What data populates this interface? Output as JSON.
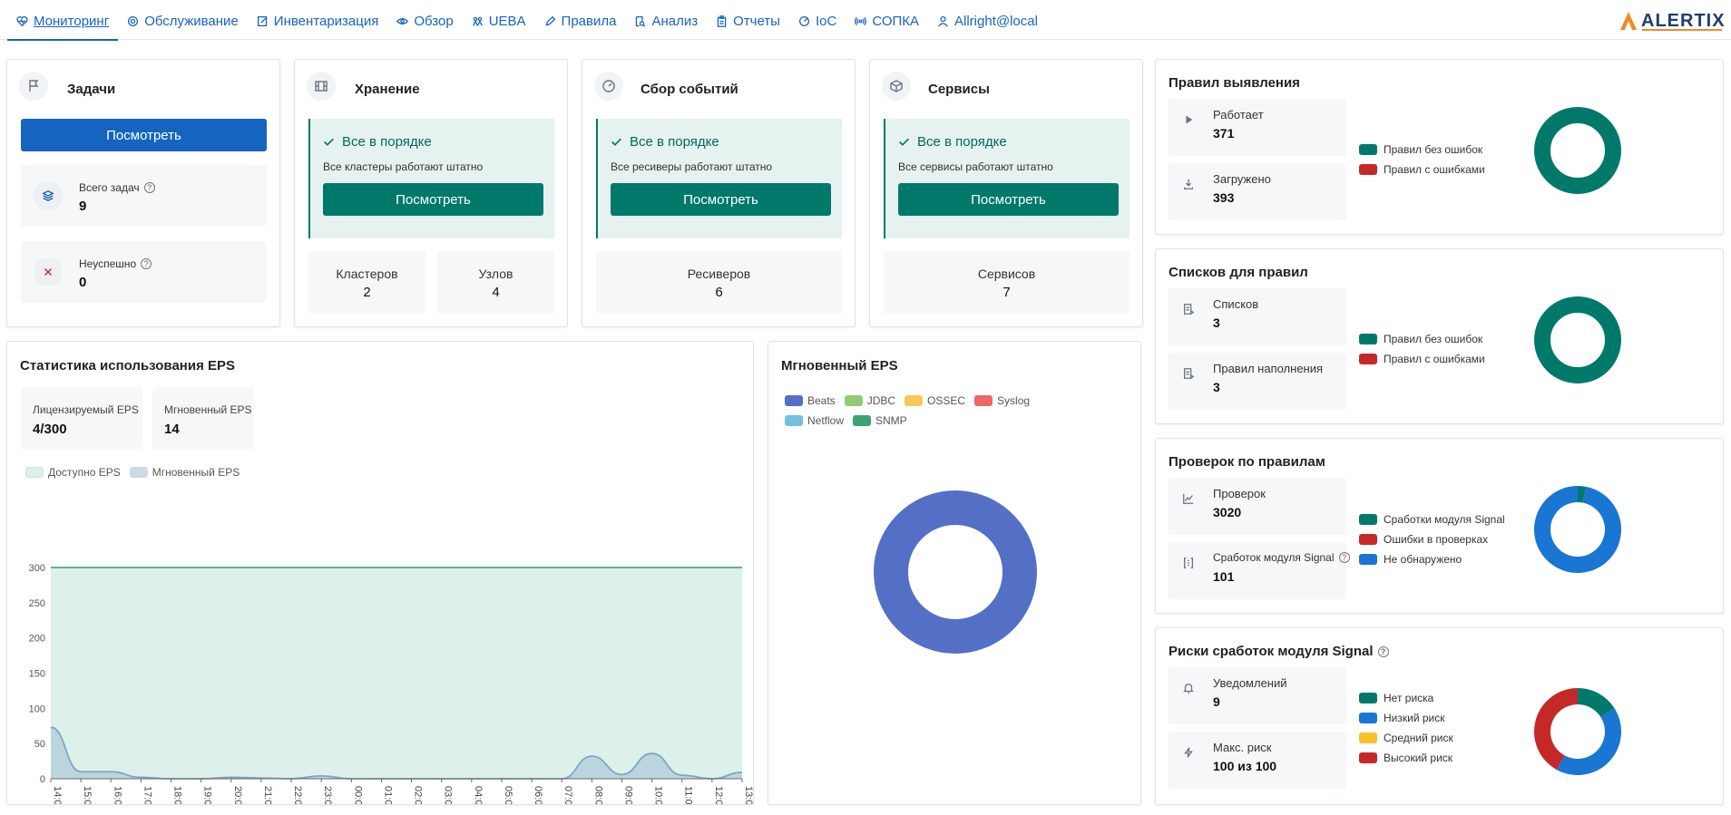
{
  "nav": {
    "items": [
      {
        "label": "Мониторинг",
        "icon": "heart-monitor-icon",
        "active": true
      },
      {
        "label": "Обслуживание",
        "icon": "gear-icon"
      },
      {
        "label": "Инвентаризация",
        "icon": "edit-icon"
      },
      {
        "label": "Обзор",
        "icon": "eye-icon"
      },
      {
        "label": "UEBA",
        "icon": "users-icon"
      },
      {
        "label": "Правила",
        "icon": "pencil-icon"
      },
      {
        "label": "Анализ",
        "icon": "search-doc-icon"
      },
      {
        "label": "Отчеты",
        "icon": "clipboard-icon"
      },
      {
        "label": "IoC",
        "icon": "target-icon"
      },
      {
        "label": "СОПКА",
        "icon": "broadcast-icon"
      },
      {
        "label": "Allright@local",
        "icon": "user-icon"
      }
    ],
    "layout_icon": "layout-columns-icon",
    "logo_text": "ALERTIX"
  },
  "tasks": {
    "title": "Задачи",
    "view_button": "Посмотреть",
    "total_label": "Всего задач",
    "total_value": "9",
    "failed_label": "Неуспешно",
    "failed_value": "0"
  },
  "storage": {
    "title": "Хранение",
    "ok_title": "Все в порядке",
    "ok_sub": "Все кластеры работают штатно",
    "view_button": "Посмотреть",
    "clusters_label": "Кластеров",
    "clusters_value": "2",
    "nodes_label": "Узлов",
    "nodes_value": "4"
  },
  "collection": {
    "title": "Сбор событий",
    "ok_title": "Все в порядке",
    "ok_sub": "Все ресиверы работают штатно",
    "view_button": "Посмотреть",
    "receivers_label": "Ресиверов",
    "receivers_value": "6"
  },
  "services": {
    "title": "Сервисы",
    "ok_title": "Все в порядке",
    "ok_sub": "Все сервисы работают штатно",
    "view_button": "Посмотреть",
    "services_label": "Сервисов",
    "services_value": "7"
  },
  "eps_stats": {
    "title": "Статистика использования EPS",
    "licensed_label": "Лицензируемый EPS",
    "licensed_value": "4/300",
    "instant_label": "Мгновенный EPS",
    "instant_value": "14",
    "legend_available": "Доступно EPS",
    "legend_instant": "Мгновенный EPS"
  },
  "instant_eps": {
    "title": "Мгновенный EPS",
    "legend": [
      {
        "name": "Beats",
        "color": "#5470c6"
      },
      {
        "name": "JDBC",
        "color": "#91cc75"
      },
      {
        "name": "OSSEC",
        "color": "#fac858"
      },
      {
        "name": "Syslog",
        "color": "#ee6666"
      },
      {
        "name": "Netflow",
        "color": "#73c0de"
      },
      {
        "name": "SNMP",
        "color": "#3ba272"
      }
    ]
  },
  "detection_rules": {
    "title": "Правил выявления",
    "running_label": "Работает",
    "running_value": "371",
    "loaded_label": "Загружено",
    "loaded_value": "393",
    "legend_ok": "Правил без ошибок",
    "legend_err": "Правил с ошибками"
  },
  "rule_lists": {
    "title": "Списков для правил",
    "lists_label": "Списков",
    "lists_value": "3",
    "fill_label": "Правил наполнения",
    "fill_value": "3",
    "legend_ok": "Правил без ошибок",
    "legend_err": "Правил с ошибками"
  },
  "rule_checks": {
    "title": "Проверок по правилам",
    "checks_label": "Проверок",
    "checks_value": "3020",
    "signal_label": "Сработок модуля Signal",
    "signal_value": "101",
    "legend_signal": "Сработки модуля Signal",
    "legend_errors": "Ошибки в проверках",
    "legend_notfound": "Не обнаружено"
  },
  "signal_risks": {
    "title": "Риски сработок модуля Signal",
    "notif_label": "Уведомлений",
    "notif_value": "9",
    "maxrisk_label": "Макс. риск",
    "maxrisk_value": "100 из 100",
    "legend_none": "Нет риска",
    "legend_low": "Низкий риск",
    "legend_mid": "Средний риск",
    "legend_high": "Высокий риск"
  },
  "colors": {
    "primary": "#1565c0",
    "teal": "#00796b",
    "red": "#c62828",
    "blue": "#1976d2",
    "yellow": "#fbc02d",
    "eps_area": "#dcf1e9",
    "eps_line": "#7aa7c7",
    "donut_beats": "#5470c6"
  },
  "chart_data": [
    {
      "type": "area",
      "title": "",
      "x": [
        "14:00",
        "15:00",
        "16:00",
        "17:00",
        "18:00",
        "19:00",
        "20:00",
        "21:00",
        "22:00",
        "23:00",
        "00:00",
        "01:00",
        "02:00",
        "03:00",
        "04:00",
        "05:00",
        "06:00",
        "07:00",
        "08:00",
        "09:00",
        "10:00",
        "11:00",
        "12:00",
        "13:00"
      ],
      "series": [
        {
          "name": "Доступно EPS",
          "values": [
            300,
            300,
            300,
            300,
            300,
            300,
            300,
            300,
            300,
            300,
            300,
            300,
            300,
            300,
            300,
            300,
            300,
            300,
            300,
            300,
            300,
            300,
            300,
            300
          ]
        },
        {
          "name": "Мгновенный EPS",
          "values": [
            73,
            10,
            10,
            2,
            0,
            0,
            2,
            1,
            0,
            4,
            0,
            0,
            0,
            0,
            0,
            0,
            0,
            0,
            32,
            6,
            36,
            5,
            0,
            9
          ]
        }
      ],
      "yticks": [
        0,
        50,
        100,
        150,
        200,
        250,
        300
      ],
      "ylim": [
        0,
        300
      ],
      "grid": true,
      "legend_position": "top-left"
    },
    {
      "type": "pie",
      "title": "",
      "categories": [
        "Beats"
      ],
      "values": [
        100
      ]
    },
    {
      "type": "pie",
      "categories": [
        "Правил без ошибок",
        "Правил с ошибками"
      ],
      "values": [
        100,
        0
      ]
    },
    {
      "type": "pie",
      "categories": [
        "Правил без ошибок",
        "Правил с ошибками"
      ],
      "values": [
        100,
        0
      ]
    },
    {
      "type": "pie",
      "categories": [
        "Сработки модуля Signal",
        "Ошибки в проверках",
        "Не обнаружено"
      ],
      "values": [
        3,
        0,
        97
      ]
    },
    {
      "type": "pie",
      "categories": [
        "Нет риска",
        "Низкий риск",
        "Средний риск",
        "Высокий риск"
      ],
      "values": [
        16,
        42,
        0,
        42
      ]
    }
  ]
}
